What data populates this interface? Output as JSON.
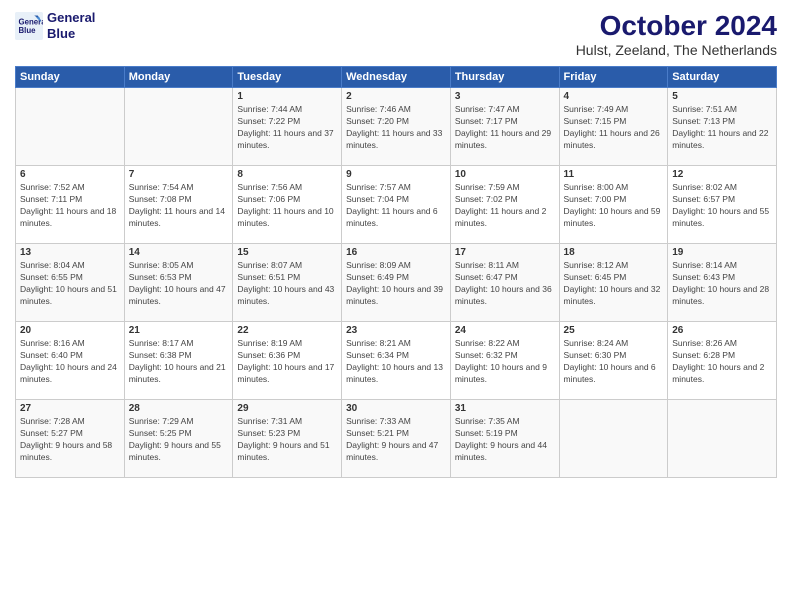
{
  "logo": {
    "line1": "General",
    "line2": "Blue"
  },
  "title": "October 2024",
  "location": "Hulst, Zeeland, The Netherlands",
  "days_of_week": [
    "Sunday",
    "Monday",
    "Tuesday",
    "Wednesday",
    "Thursday",
    "Friday",
    "Saturday"
  ],
  "weeks": [
    [
      {
        "day": "",
        "info": ""
      },
      {
        "day": "",
        "info": ""
      },
      {
        "day": "1",
        "info": "Sunrise: 7:44 AM\nSunset: 7:22 PM\nDaylight: 11 hours and 37 minutes."
      },
      {
        "day": "2",
        "info": "Sunrise: 7:46 AM\nSunset: 7:20 PM\nDaylight: 11 hours and 33 minutes."
      },
      {
        "day": "3",
        "info": "Sunrise: 7:47 AM\nSunset: 7:17 PM\nDaylight: 11 hours and 29 minutes."
      },
      {
        "day": "4",
        "info": "Sunrise: 7:49 AM\nSunset: 7:15 PM\nDaylight: 11 hours and 26 minutes."
      },
      {
        "day": "5",
        "info": "Sunrise: 7:51 AM\nSunset: 7:13 PM\nDaylight: 11 hours and 22 minutes."
      }
    ],
    [
      {
        "day": "6",
        "info": "Sunrise: 7:52 AM\nSunset: 7:11 PM\nDaylight: 11 hours and 18 minutes."
      },
      {
        "day": "7",
        "info": "Sunrise: 7:54 AM\nSunset: 7:08 PM\nDaylight: 11 hours and 14 minutes."
      },
      {
        "day": "8",
        "info": "Sunrise: 7:56 AM\nSunset: 7:06 PM\nDaylight: 11 hours and 10 minutes."
      },
      {
        "day": "9",
        "info": "Sunrise: 7:57 AM\nSunset: 7:04 PM\nDaylight: 11 hours and 6 minutes."
      },
      {
        "day": "10",
        "info": "Sunrise: 7:59 AM\nSunset: 7:02 PM\nDaylight: 11 hours and 2 minutes."
      },
      {
        "day": "11",
        "info": "Sunrise: 8:00 AM\nSunset: 7:00 PM\nDaylight: 10 hours and 59 minutes."
      },
      {
        "day": "12",
        "info": "Sunrise: 8:02 AM\nSunset: 6:57 PM\nDaylight: 10 hours and 55 minutes."
      }
    ],
    [
      {
        "day": "13",
        "info": "Sunrise: 8:04 AM\nSunset: 6:55 PM\nDaylight: 10 hours and 51 minutes."
      },
      {
        "day": "14",
        "info": "Sunrise: 8:05 AM\nSunset: 6:53 PM\nDaylight: 10 hours and 47 minutes."
      },
      {
        "day": "15",
        "info": "Sunrise: 8:07 AM\nSunset: 6:51 PM\nDaylight: 10 hours and 43 minutes."
      },
      {
        "day": "16",
        "info": "Sunrise: 8:09 AM\nSunset: 6:49 PM\nDaylight: 10 hours and 39 minutes."
      },
      {
        "day": "17",
        "info": "Sunrise: 8:11 AM\nSunset: 6:47 PM\nDaylight: 10 hours and 36 minutes."
      },
      {
        "day": "18",
        "info": "Sunrise: 8:12 AM\nSunset: 6:45 PM\nDaylight: 10 hours and 32 minutes."
      },
      {
        "day": "19",
        "info": "Sunrise: 8:14 AM\nSunset: 6:43 PM\nDaylight: 10 hours and 28 minutes."
      }
    ],
    [
      {
        "day": "20",
        "info": "Sunrise: 8:16 AM\nSunset: 6:40 PM\nDaylight: 10 hours and 24 minutes."
      },
      {
        "day": "21",
        "info": "Sunrise: 8:17 AM\nSunset: 6:38 PM\nDaylight: 10 hours and 21 minutes."
      },
      {
        "day": "22",
        "info": "Sunrise: 8:19 AM\nSunset: 6:36 PM\nDaylight: 10 hours and 17 minutes."
      },
      {
        "day": "23",
        "info": "Sunrise: 8:21 AM\nSunset: 6:34 PM\nDaylight: 10 hours and 13 minutes."
      },
      {
        "day": "24",
        "info": "Sunrise: 8:22 AM\nSunset: 6:32 PM\nDaylight: 10 hours and 9 minutes."
      },
      {
        "day": "25",
        "info": "Sunrise: 8:24 AM\nSunset: 6:30 PM\nDaylight: 10 hours and 6 minutes."
      },
      {
        "day": "26",
        "info": "Sunrise: 8:26 AM\nSunset: 6:28 PM\nDaylight: 10 hours and 2 minutes."
      }
    ],
    [
      {
        "day": "27",
        "info": "Sunrise: 7:28 AM\nSunset: 5:27 PM\nDaylight: 9 hours and 58 minutes."
      },
      {
        "day": "28",
        "info": "Sunrise: 7:29 AM\nSunset: 5:25 PM\nDaylight: 9 hours and 55 minutes."
      },
      {
        "day": "29",
        "info": "Sunrise: 7:31 AM\nSunset: 5:23 PM\nDaylight: 9 hours and 51 minutes."
      },
      {
        "day": "30",
        "info": "Sunrise: 7:33 AM\nSunset: 5:21 PM\nDaylight: 9 hours and 47 minutes."
      },
      {
        "day": "31",
        "info": "Sunrise: 7:35 AM\nSunset: 5:19 PM\nDaylight: 9 hours and 44 minutes."
      },
      {
        "day": "",
        "info": ""
      },
      {
        "day": "",
        "info": ""
      }
    ]
  ]
}
